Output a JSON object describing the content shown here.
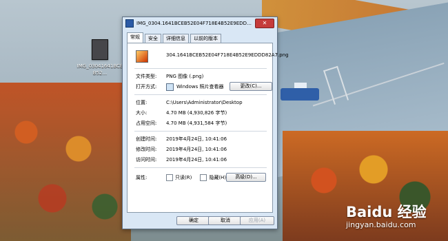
{
  "desktop": {
    "file_icon_label": "IMG_03041641BCEB52..."
  },
  "dialog": {
    "title": "IMG_0304.1641BCEB52E04F718E4B52E9EDDD82...",
    "tabs": [
      "常规",
      "安全",
      "详细信息",
      "以前的版本"
    ],
    "file_name": "304.1641BCEB52E04F718E4B52E9EDDD82A7.png",
    "type_label": "文件类型:",
    "type_value": "PNG 图像 (.png)",
    "open_label": "打开方式:",
    "open_value": "Windows 照片查看器",
    "change_button": "更改(C)...",
    "location_label": "位置:",
    "location_value": "C:\\Users\\Administrator\\Desktop",
    "size_label": "大小:",
    "size_value": "4.70 MB (4,930,826 字节)",
    "disk_label": "占用空间:",
    "disk_value": "4.70 MB (4,931,584 字节)",
    "created_label": "创建时间:",
    "created_value": "2019年4月24日, 10:41:06",
    "modified_label": "修改时间:",
    "modified_value": "2019年4月24日, 10:41:06",
    "accessed_label": "访问时间:",
    "accessed_value": "2019年4月24日, 10:41:06",
    "attributes_label": "属性:",
    "readonly_label": "只读(R)",
    "hidden_label": "隐藏(H)",
    "advanced_button": "高级(D)...",
    "ok_button": "确定",
    "cancel_button": "取消",
    "apply_button": "应用(A)"
  },
  "watermark": {
    "brand": "Baidu 经验",
    "site": "jingyan.baidu.com"
  },
  "colors": {
    "dialog_bg": "#d9e7f5",
    "panel_bg": "#ffffff",
    "close_red": "#c53b3b"
  }
}
